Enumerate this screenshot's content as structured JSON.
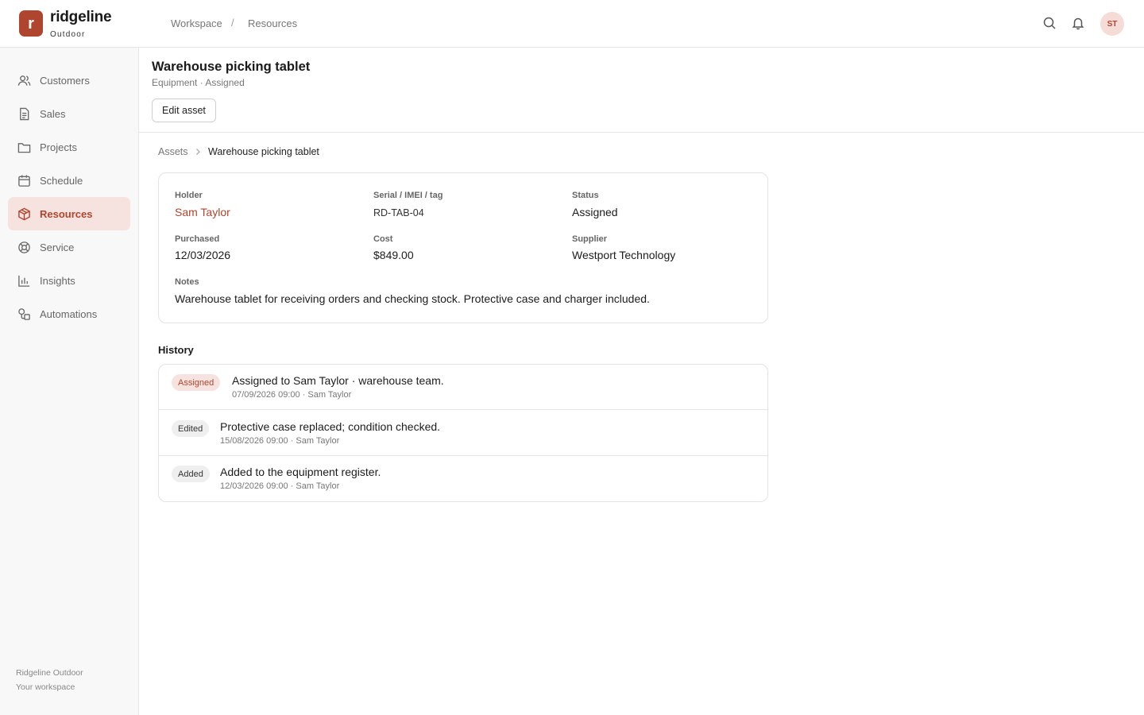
{
  "brand": {
    "initial": "r",
    "name": "ridgeline",
    "sub": "Outdoor",
    "color": "#b0452f"
  },
  "topnav": {
    "workspace": "Workspace",
    "separator": "/",
    "resources": "Resources"
  },
  "user": {
    "initials": "ST"
  },
  "sidebar": {
    "items": [
      {
        "label": "Customers",
        "icon": "users-icon"
      },
      {
        "label": "Sales",
        "icon": "document-icon"
      },
      {
        "label": "Projects",
        "icon": "folder-icon"
      },
      {
        "label": "Schedule",
        "icon": "calendar-icon"
      },
      {
        "label": "Resources",
        "icon": "box-icon",
        "active": true
      },
      {
        "label": "Service",
        "icon": "lifebuoy-icon"
      },
      {
        "label": "Insights",
        "icon": "bar-chart-icon"
      },
      {
        "label": "Automations",
        "icon": "shapes-icon"
      }
    ],
    "footer": {
      "org": "Ridgeline Outdoor",
      "workspace": "Your workspace"
    }
  },
  "page": {
    "title": "Warehouse picking tablet",
    "subtitle": "Equipment · Assigned",
    "edit_label": "Edit asset"
  },
  "breadcrumb": {
    "parent": "Assets",
    "current": "Warehouse picking tablet"
  },
  "details": {
    "holder_label": "Holder",
    "holder": "Sam Taylor",
    "serial_label": "Serial / IMEI / tag",
    "serial": "RD-TAB-04",
    "status_label": "Status",
    "status": "Assigned",
    "purchased_label": "Purchased",
    "purchased": "12/03/2026",
    "cost_label": "Cost",
    "cost": "$849.00",
    "supplier_label": "Supplier",
    "supplier": "Westport Technology",
    "notes_label": "Notes",
    "notes": "Warehouse tablet for receiving orders and checking stock. Protective case and charger included."
  },
  "history": {
    "title": "History",
    "entries": [
      {
        "badge": "Assigned",
        "text": "Assigned to Sam Taylor · warehouse team.",
        "meta": "07/09/2026 09:00 · Sam Taylor"
      },
      {
        "badge": "Edited",
        "text": "Protective case replaced; condition checked.",
        "meta": "15/08/2026 09:00 · Sam Taylor"
      },
      {
        "badge": "Added",
        "text": "Added to the equipment register.",
        "meta": "12/03/2026 09:00 · Sam Taylor"
      }
    ]
  }
}
